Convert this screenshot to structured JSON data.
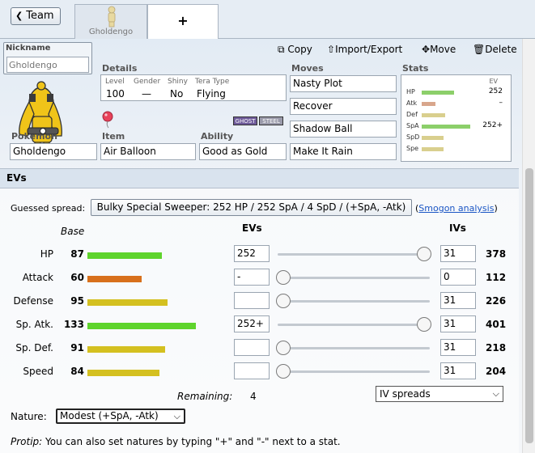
{
  "topbar": {
    "team_label": "Team",
    "tab_pokemon_label": "Gholdengo",
    "tab_add_label": "+"
  },
  "editor": {
    "nickname_label": "Nickname",
    "nickname_placeholder": "Gholdengo",
    "actions": {
      "copy": "Copy",
      "import_export": "Import/Export",
      "move": "Move",
      "delete": "Delete"
    },
    "details": {
      "label": "Details",
      "level_label": "Level",
      "level": "100",
      "gender_label": "Gender",
      "gender": "—",
      "shiny_label": "Shiny",
      "shiny": "No",
      "tera_label": "Tera Type",
      "tera": "Flying"
    },
    "types": [
      "GHOST",
      "STEEL"
    ],
    "pokemon_label": "Pokémon",
    "pokemon": "Gholdengo",
    "item_label": "Item",
    "item": "Air Balloon",
    "ability_label": "Ability",
    "ability": "Good as Gold",
    "moves_label": "Moves",
    "moves": [
      "Nasty Plot",
      "Recover",
      "Shadow Ball",
      "Make It Rain"
    ],
    "stats_label": "Stats",
    "stats_ev_header": "EV",
    "mini_stats": [
      {
        "name": "HP",
        "ev": "252"
      },
      {
        "name": "Atk",
        "ev": "–"
      },
      {
        "name": "Def",
        "ev": ""
      },
      {
        "name": "SpA",
        "ev": "252+"
      },
      {
        "name": "SpD",
        "ev": ""
      },
      {
        "name": "Spe",
        "ev": ""
      }
    ]
  },
  "evs": {
    "title": "EVs",
    "guessed_label": "Guessed spread:",
    "guessed_spread": "Bulky Special Sweeper: 252 HP / 252 SpA / 4 SpD / (+SpA, -Atk)",
    "smogon_open": "(",
    "smogon_link": "Smogon analysis",
    "smogon_close": ")",
    "base_header": "Base",
    "evs_header": "EVs",
    "ivs_header": "IVs",
    "stats": [
      {
        "name": "HP",
        "base": "87",
        "ev": "252",
        "iv": "31",
        "total": "378",
        "slider": 1.0,
        "color": "#5fd42c"
      },
      {
        "name": "Attack",
        "base": "60",
        "ev": "-",
        "iv": "0",
        "total": "112",
        "slider": 0.0,
        "color": "#d8701c"
      },
      {
        "name": "Defense",
        "base": "95",
        "ev": "",
        "iv": "31",
        "total": "226",
        "slider": 0.0,
        "color": "#d4c020"
      },
      {
        "name": "Sp. Atk.",
        "base": "133",
        "ev": "252+",
        "iv": "31",
        "total": "401",
        "slider": 1.0,
        "color": "#5fd42c"
      },
      {
        "name": "Sp. Def.",
        "base": "91",
        "ev": "",
        "iv": "31",
        "total": "218",
        "slider": 0.0,
        "color": "#d4c020"
      },
      {
        "name": "Speed",
        "base": "84",
        "ev": "",
        "iv": "31",
        "total": "204",
        "slider": 0.0,
        "color": "#d4c020"
      }
    ],
    "remaining_label": "Remaining:",
    "remaining": "4",
    "iv_spreads": "IV spreads",
    "nature_label": "Nature:",
    "nature": "Modest (+SpA, -Atk)",
    "protip_label": "Protip:",
    "protip": " You can also set natures by typing \"+\" and \"-\" next to a stat."
  }
}
